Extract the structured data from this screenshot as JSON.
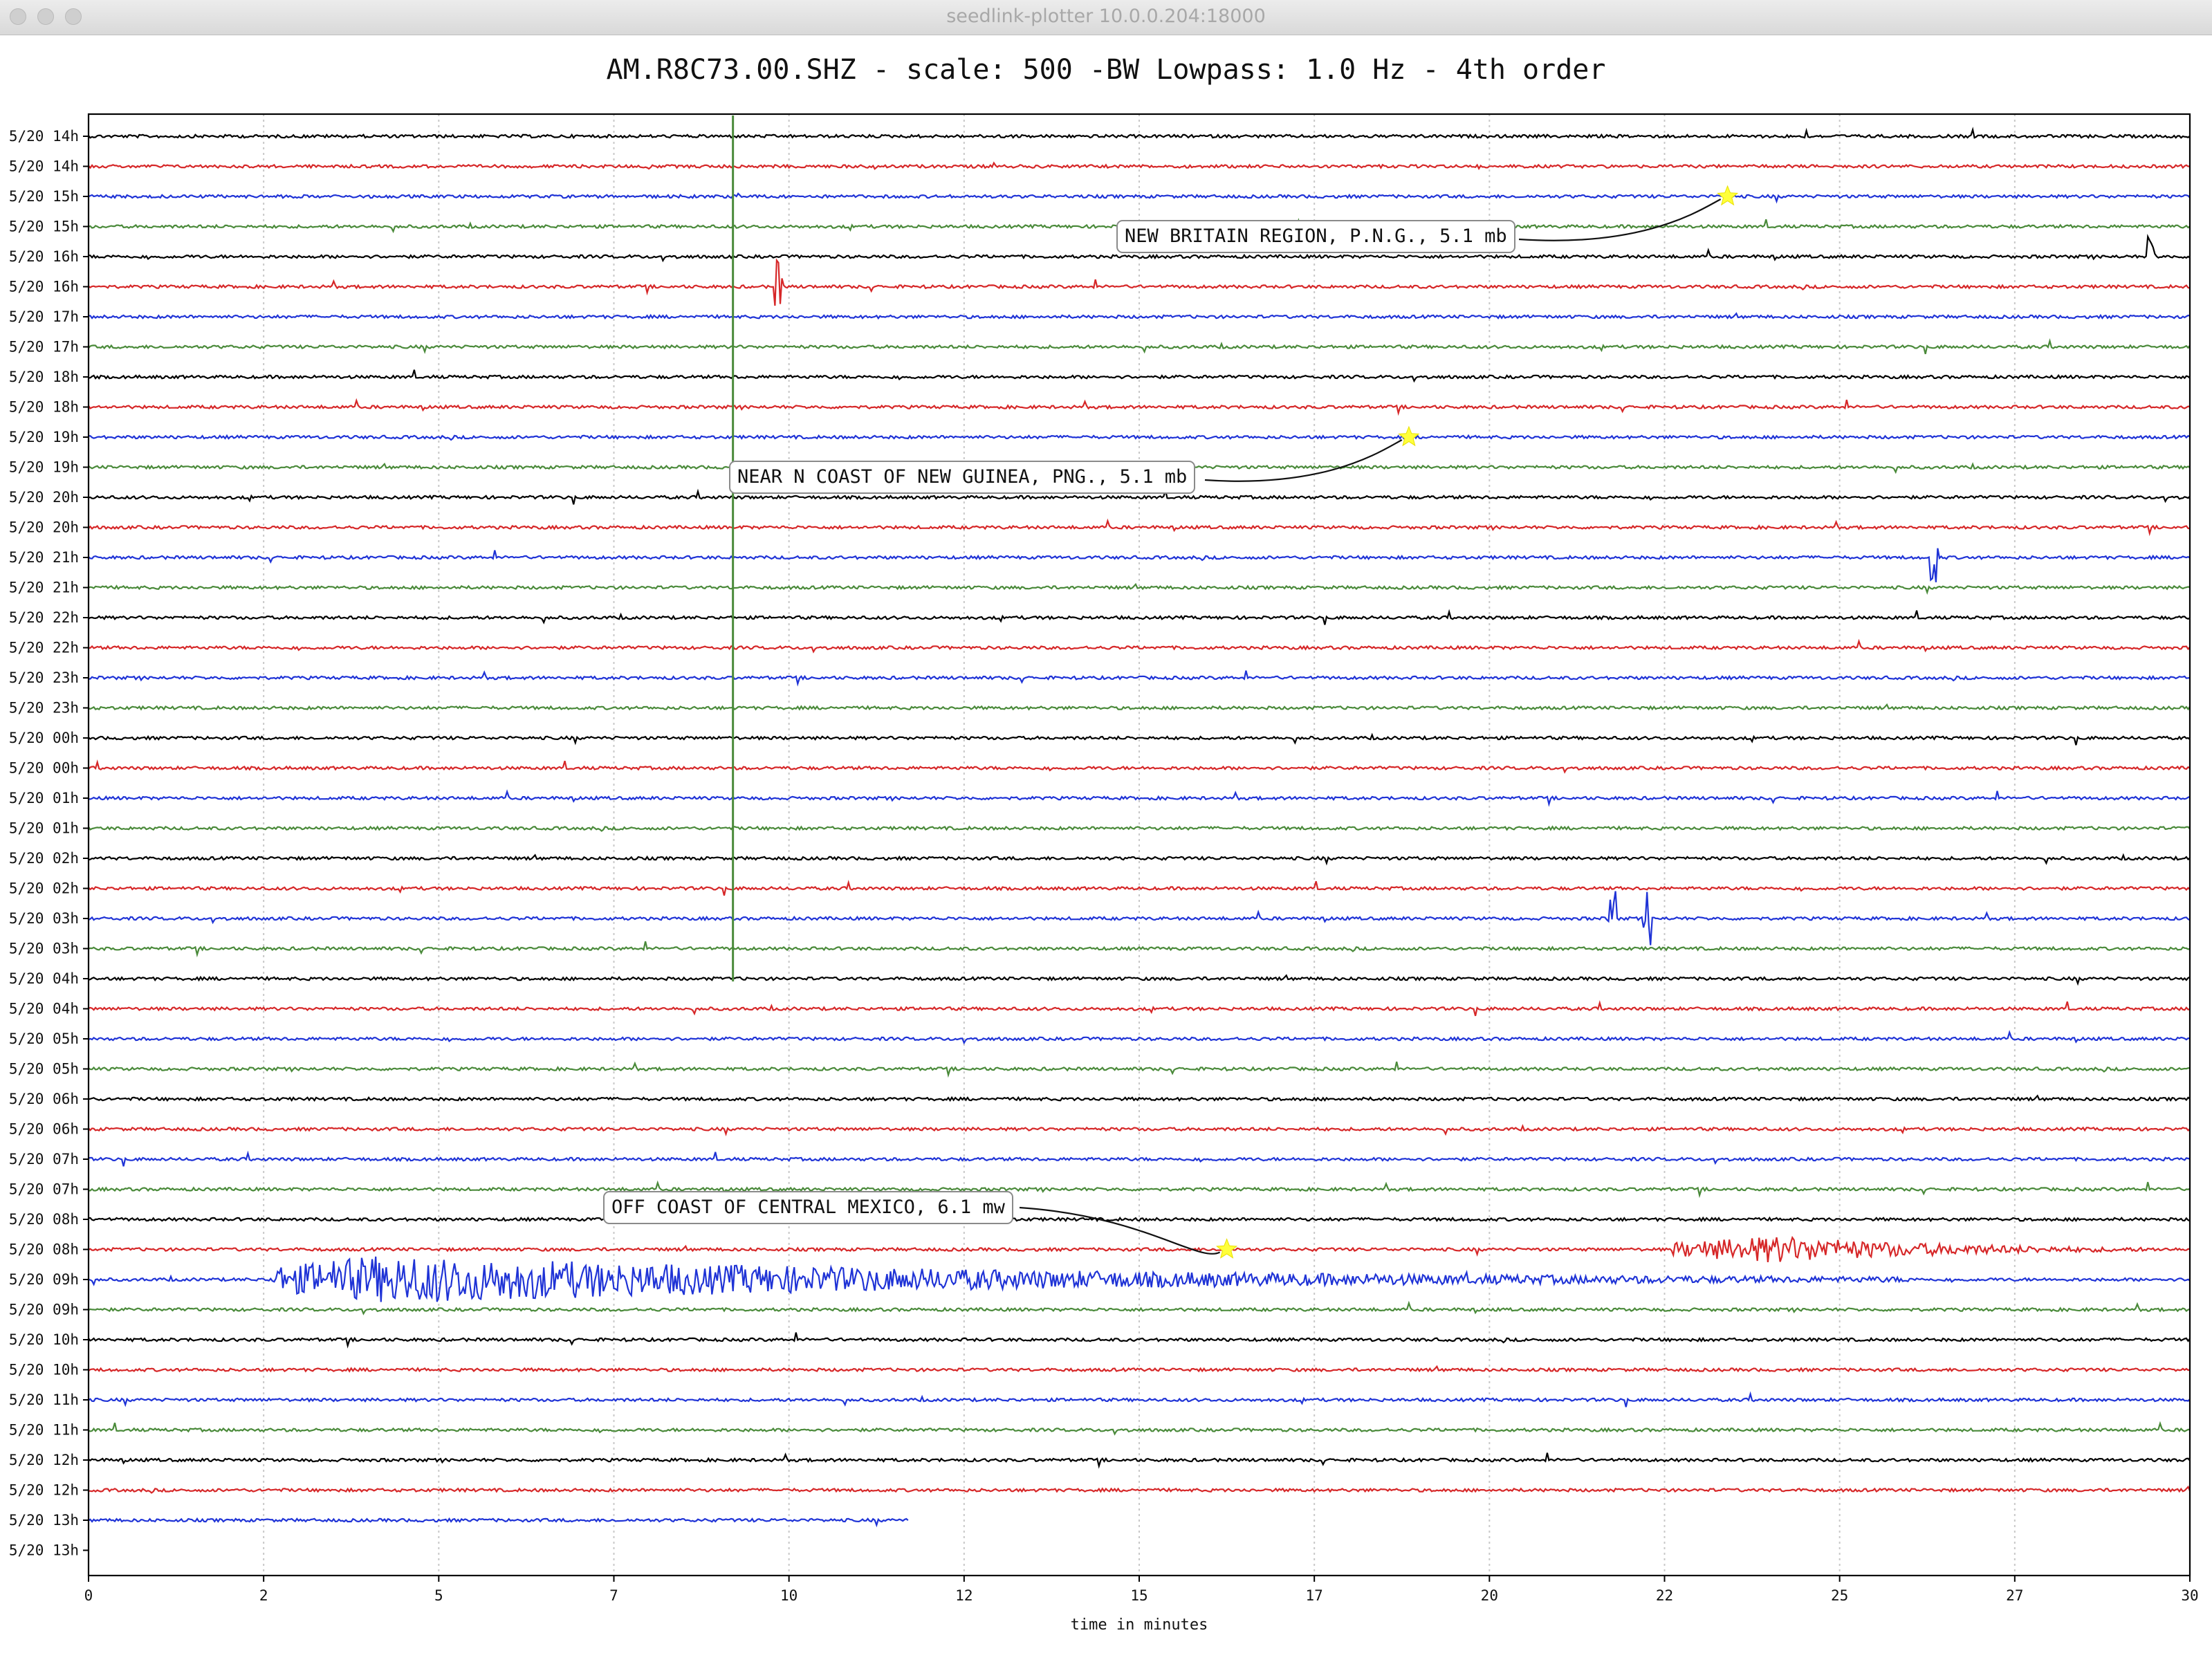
{
  "window": {
    "title": "seedlink-plotter 10.0.0.204:18000"
  },
  "chart_data": {
    "type": "line",
    "title": "AM.R8C73.00.SHZ - scale: 500 -BW Lowpass: 1.0 Hz - 4th order",
    "xlabel": "time in minutes",
    "ylabel": "",
    "xlim": [
      0,
      30
    ],
    "x_ticks": [
      "0",
      "2",
      "5",
      "7",
      "10",
      "12",
      "15",
      "17",
      "20",
      "22",
      "25",
      "27",
      "30"
    ],
    "x_tick_values": [
      0,
      2.5,
      5,
      7.5,
      10,
      12.5,
      15,
      17.5,
      20,
      22.5,
      25,
      27.5,
      30
    ],
    "grid": "vertical",
    "trace_colors": [
      "#000000",
      "#d62728",
      "#1f33d6",
      "#4a8a3a"
    ],
    "row_labels": [
      "5/20 14h",
      "5/20 14h",
      "5/20 15h",
      "5/20 15h",
      "5/20 16h",
      "5/20 16h",
      "5/20 17h",
      "5/20 17h",
      "5/20 18h",
      "5/20 18h",
      "5/20 19h",
      "5/20 19h",
      "5/20 20h",
      "5/20 20h",
      "5/20 21h",
      "5/20 21h",
      "5/20 22h",
      "5/20 22h",
      "5/20 23h",
      "5/20 23h",
      "5/20 00h",
      "5/20 00h",
      "5/20 01h",
      "5/20 01h",
      "5/20 02h",
      "5/20 02h",
      "5/20 03h",
      "5/20 03h",
      "5/20 04h",
      "5/20 04h",
      "5/20 05h",
      "5/20 05h",
      "5/20 06h",
      "5/20 06h",
      "5/20 07h",
      "5/20 07h",
      "5/20 08h",
      "5/20 08h",
      "5/20 09h",
      "5/20 09h",
      "5/20 10h",
      "5/20 10h",
      "5/20 11h",
      "5/20 11h",
      "5/20 12h",
      "5/20 12h",
      "5/20 13h",
      "5/20 13h"
    ],
    "last_trace_end_minutes": 11.7,
    "events": [
      {
        "label": "NEW BRITAIN REGION, P.N.G., 5.1 mb",
        "row": 2,
        "minute": 23.4
      },
      {
        "label": "NEAR N COAST OF NEW GUINEA, PNG., 5.1 mb",
        "row": 10,
        "minute": 18.85
      },
      {
        "label": "OFF COAST OF CENTRAL MEXICO, 6.1 mw",
        "row": 37,
        "minute": 16.25
      }
    ],
    "signals": [
      {
        "row": 38,
        "start": 2.6,
        "end": 26,
        "peak": 4.2,
        "amplitude": 0.8,
        "kind": "quake"
      },
      {
        "row": 37,
        "start": 22.6,
        "end": 30,
        "peak": 24.1,
        "amplitude": 0.45,
        "kind": "quake"
      },
      {
        "row": 26,
        "start": 21.7,
        "end": 21.8,
        "peak": 21.75,
        "amplitude": 1.1,
        "kind": "spike"
      },
      {
        "row": 26,
        "start": 22.2,
        "end": 22.3,
        "peak": 22.25,
        "amplitude": 1.0,
        "kind": "spike"
      },
      {
        "row": 14,
        "start": 26.3,
        "end": 26.4,
        "peak": 26.35,
        "amplitude": 0.9,
        "kind": "spike"
      },
      {
        "row": 5,
        "start": 9.8,
        "end": 9.9,
        "peak": 9.85,
        "amplitude": 0.9,
        "kind": "spike"
      },
      {
        "row": 4,
        "start": 29.4,
        "end": 29.5,
        "peak": 29.45,
        "amplitude": 0.7,
        "kind": "spike"
      }
    ],
    "vertical_glitch": {
      "minute": 9.2,
      "from_row": 0,
      "to_row": 28,
      "color": "#4a8a3a"
    }
  }
}
